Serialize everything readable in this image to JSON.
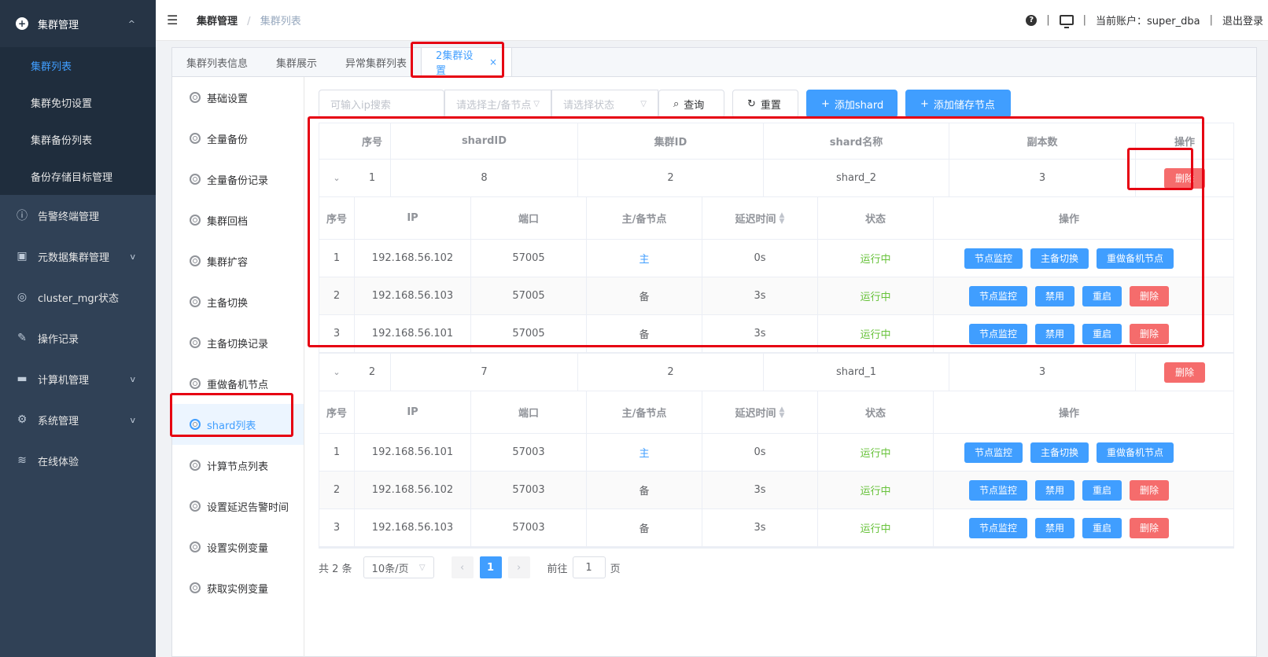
{
  "sidebar": {
    "group": {
      "label": "集群管理",
      "icon": "plus-circle-icon",
      "chevron": "^"
    },
    "sub_items": [
      {
        "label": "集群列表",
        "active": true
      },
      {
        "label": "集群免切设置"
      },
      {
        "label": "集群备份列表"
      },
      {
        "label": "备份存储目标管理"
      }
    ],
    "items": [
      {
        "label": "告警终端管理",
        "icon": "alert-icon",
        "chevron": ""
      },
      {
        "label": "元数据集群管理",
        "icon": "database-icon",
        "chevron": "v"
      },
      {
        "label": "cluster_mgr状态",
        "icon": "status-icon",
        "chevron": ""
      },
      {
        "label": "操作记录",
        "icon": "record-icon",
        "chevron": ""
      },
      {
        "label": "计算机管理",
        "icon": "computer-icon",
        "chevron": "v"
      },
      {
        "label": "系统管理",
        "icon": "settings-icon",
        "chevron": "v"
      },
      {
        "label": "在线体验",
        "icon": "stack-icon",
        "chevron": ""
      }
    ]
  },
  "navbar": {
    "breadcrumb": [
      "集群管理",
      "集群列表"
    ],
    "separator": "/",
    "account": "当前账户：super_dba",
    "logout": "退出登录",
    "divider": "|"
  },
  "tabs": [
    {
      "label": "集群列表信息"
    },
    {
      "label": "集群展示"
    },
    {
      "label": "异常集群列表"
    },
    {
      "label": "2集群设置",
      "active": true,
      "close": "×"
    }
  ],
  "inner_menu": [
    "基础设置",
    "全量备份",
    "全量备份记录",
    "集群回档",
    "集群扩容",
    "主备切换",
    "主备切换记录",
    "重做备机节点",
    "shard列表",
    "计算节点列表",
    "设置延迟告警时间",
    "设置实例变量",
    "获取实例变量"
  ],
  "inner_menu_active": "shard列表",
  "toolbar": {
    "ip_placeholder": "可输入ip搜索",
    "node_placeholder": "请选择主/备节点",
    "state_placeholder": "请选择状态",
    "query": "查询",
    "reset": "重置",
    "add_shard": "添加shard",
    "add_storage": "添加储存节点"
  },
  "table": {
    "headers": [
      "序号",
      "shardID",
      "集群ID",
      "shard名称",
      "副本数",
      "操作"
    ],
    "sub_headers": [
      "序号",
      "IP",
      "端口",
      "主/备节点",
      "延迟时间",
      "状态",
      "操作"
    ],
    "delete_label": "删除",
    "rows": [
      {
        "idx": "1",
        "shard_id": "8",
        "cluster_id": "2",
        "name": "shard_2",
        "replicas": "3",
        "nodes": [
          {
            "idx": "1",
            "ip": "192.168.56.102",
            "port": "57005",
            "role": "主",
            "delay": "0s",
            "state": "运行中",
            "master": true
          },
          {
            "idx": "2",
            "ip": "192.168.56.103",
            "port": "57005",
            "role": "备",
            "delay": "3s",
            "state": "运行中",
            "master": false
          },
          {
            "idx": "3",
            "ip": "192.168.56.101",
            "port": "57005",
            "role": "备",
            "delay": "3s",
            "state": "运行中",
            "master": false
          }
        ]
      },
      {
        "idx": "2",
        "shard_id": "7",
        "cluster_id": "2",
        "name": "shard_1",
        "replicas": "3",
        "nodes": [
          {
            "idx": "1",
            "ip": "192.168.56.101",
            "port": "57003",
            "role": "主",
            "delay": "0s",
            "state": "运行中",
            "master": true
          },
          {
            "idx": "2",
            "ip": "192.168.56.102",
            "port": "57003",
            "role": "备",
            "delay": "3s",
            "state": "运行中",
            "master": false
          },
          {
            "idx": "3",
            "ip": "192.168.56.103",
            "port": "57003",
            "role": "备",
            "delay": "3s",
            "state": "运行中",
            "master": false
          }
        ]
      }
    ],
    "master_actions": [
      "节点监控",
      "主备切换",
      "重做备机节点"
    ],
    "slave_actions": [
      "节点监控",
      "禁用",
      "重启",
      "删除"
    ]
  },
  "pager": {
    "total": "共 2 条",
    "size": "10条/页",
    "current": "1",
    "goto": "前往",
    "page_value": "1",
    "page_suffix": "页"
  },
  "colors": {
    "primary": "#409eff",
    "danger": "#f56c6c",
    "success": "#67c23a",
    "sidebar": "#304156",
    "highlight": "#e60012"
  }
}
